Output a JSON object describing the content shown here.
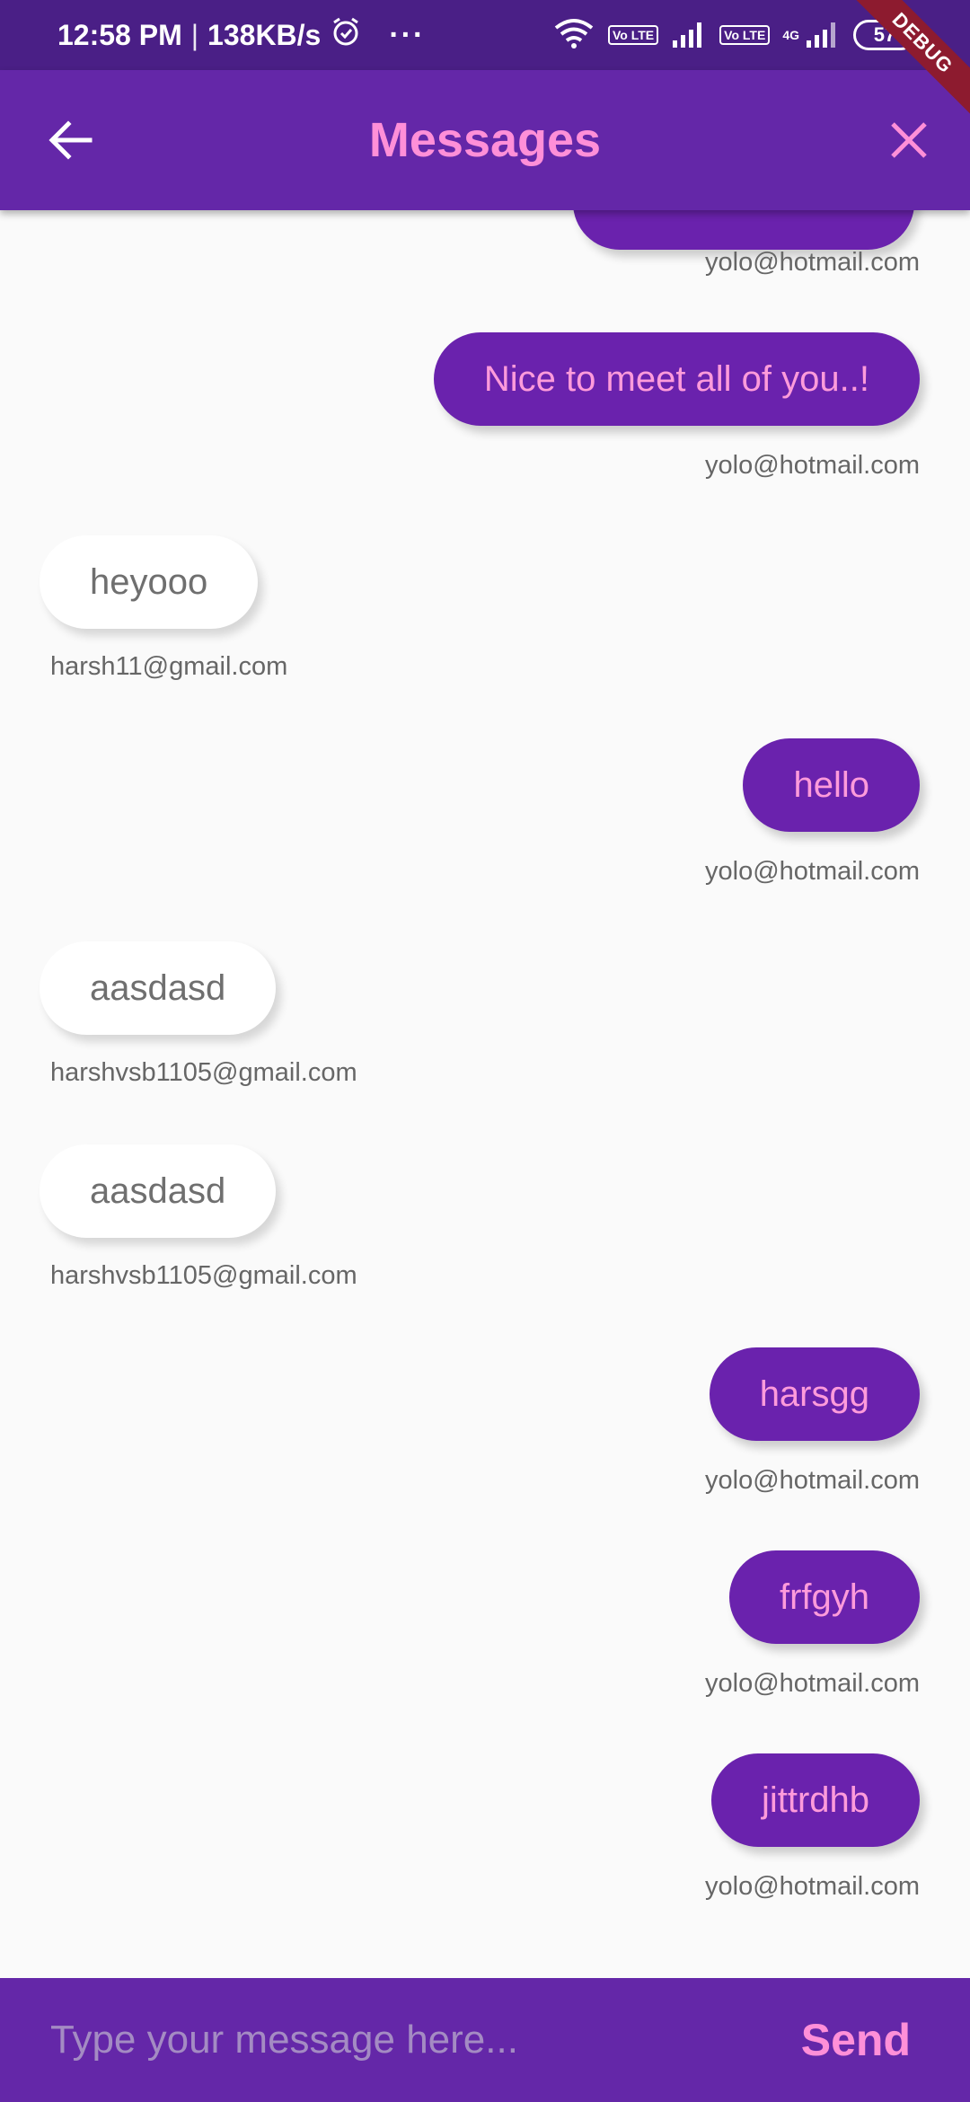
{
  "status_bar": {
    "time": "12:58 PM",
    "separator": "|",
    "speed": "138KB/s",
    "more": "···",
    "volte1": "Vo LTE",
    "volte2": "Vo LTE",
    "network": "4G",
    "battery": "57",
    "debug_banner": "DEBUG",
    "icons": [
      "alarm-icon",
      "wifi-icon",
      "signal-icon",
      "battery-icon"
    ]
  },
  "app_bar": {
    "title": "Messages",
    "back_icon": "arrow-back-icon",
    "close_icon": "close-icon"
  },
  "messages": [
    {
      "text": "",
      "sender": "yolo@hotmail.com",
      "direction": "sent"
    },
    {
      "text": "Nice to meet all of you..!",
      "sender": "yolo@hotmail.com",
      "direction": "sent"
    },
    {
      "text": "heyooo",
      "sender": "harsh11@gmail.com",
      "direction": "received"
    },
    {
      "text": "hello",
      "sender": "yolo@hotmail.com",
      "direction": "sent"
    },
    {
      "text": "aasdasd",
      "sender": "harshvsb1105@gmail.com",
      "direction": "received"
    },
    {
      "text": "aasdasd",
      "sender": "harshvsb1105@gmail.com",
      "direction": "received"
    },
    {
      "text": "harsgg",
      "sender": "yolo@hotmail.com",
      "direction": "sent"
    },
    {
      "text": "frfgyh",
      "sender": "yolo@hotmail.com",
      "direction": "sent"
    },
    {
      "text": "jittrdhb",
      "sender": "yolo@hotmail.com",
      "direction": "sent"
    }
  ],
  "composer": {
    "placeholder": "Type your message here...",
    "value": "",
    "send_label": "Send"
  },
  "colors": {
    "status_bar": "#4a1f86",
    "app_bar": "#6427a8",
    "accent_pink": "#ff8fd8",
    "sent_bubble": "#6a22ad",
    "received_bubble": "#ffffff",
    "background": "#fafafa"
  }
}
